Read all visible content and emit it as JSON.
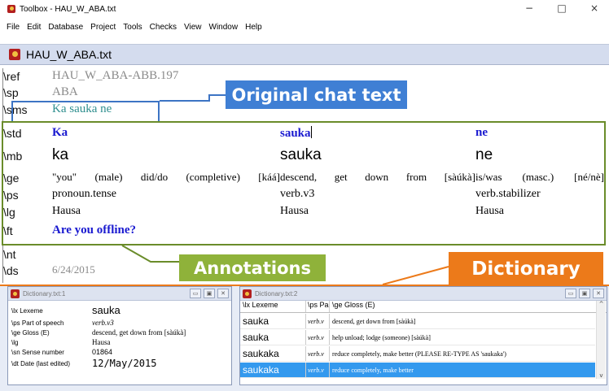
{
  "window": {
    "title": "Toolbox - HAU_W_ABA.txt",
    "minimize": "−",
    "maximize": "□",
    "close": "×"
  },
  "menu": [
    "File",
    "Edit",
    "Database",
    "Project",
    "Tools",
    "Checks",
    "View",
    "Window",
    "Help"
  ],
  "document": {
    "title": "HAU_W_ABA.txt"
  },
  "record": {
    "markers": {
      "ref": "\\ref",
      "sp": "\\sp",
      "sms": "\\sms",
      "std": "\\std",
      "mb": "\\mb",
      "ge": "\\ge",
      "ps": "\\ps",
      "lg": "\\lg",
      "ft": "\\ft",
      "nt": "\\nt",
      "ds": "\\ds"
    },
    "ref": "HAU_W_ABA-ABB.197",
    "sp": "ABA",
    "sms": "Ka sauka ne",
    "std": [
      "Ka",
      "sauka",
      "ne"
    ],
    "mb": [
      "ka",
      "sauka",
      "ne"
    ],
    "ge": [
      "\"you\" (male) did/do (completive) [káá]",
      "descend, get down from [sàúkà]",
      "is/was (masc.) [né/nè]"
    ],
    "ps": [
      "pronoun.tense",
      "verb.v3",
      "verb.stabilizer"
    ],
    "lg": [
      "Hausa",
      "Hausa",
      "Hausa"
    ],
    "ft": "Are you offline?",
    "ds": "6/24/2015"
  },
  "labels": {
    "chat": "Original chat text",
    "annotations": "Annotations",
    "dictionary": "Dictionary"
  },
  "colors": {
    "chat": "#3f7fd4",
    "annotations": "#8fb23a",
    "dictionary": "#ec7a1a",
    "selection": "#3399ee"
  },
  "dict1": {
    "title": "Dictionary.txt:1",
    "fields": [
      {
        "marker": "\\lx Lexeme",
        "value": "sauka"
      },
      {
        "marker": "\\ps Part of speech",
        "value": "verb.v3"
      },
      {
        "marker": "\\ge Gloss (E)",
        "value": "descend, get down from [sàúkà]"
      },
      {
        "marker": "\\lg",
        "value": "Hausa"
      },
      {
        "marker": "\\sn Sense number",
        "value": "01864"
      },
      {
        "marker": "\\dt Date (last edited)",
        "value": "12/May/2015"
      }
    ]
  },
  "dict2": {
    "title": "Dictionary.txt:2",
    "headers": [
      "\\lx Lexeme",
      "\\ps Pa",
      "\\ge Gloss (E)"
    ],
    "rows": [
      {
        "lx": "sauka",
        "ps": "verb.v",
        "ge": "descend, get down from [sàúkà]"
      },
      {
        "lx": "sauka",
        "ps": "verb.v",
        "ge": "help unload; lodge (someone) [sàúkà]"
      },
      {
        "lx": "saukaka",
        "ps": "verb.v",
        "ge": "reduce completely, make better (PLEASE RE-TYPE AS 'saukaka')"
      },
      {
        "lx": "saukaka",
        "ps": "verb.v",
        "ge": "reduce completely, make better"
      }
    ]
  }
}
